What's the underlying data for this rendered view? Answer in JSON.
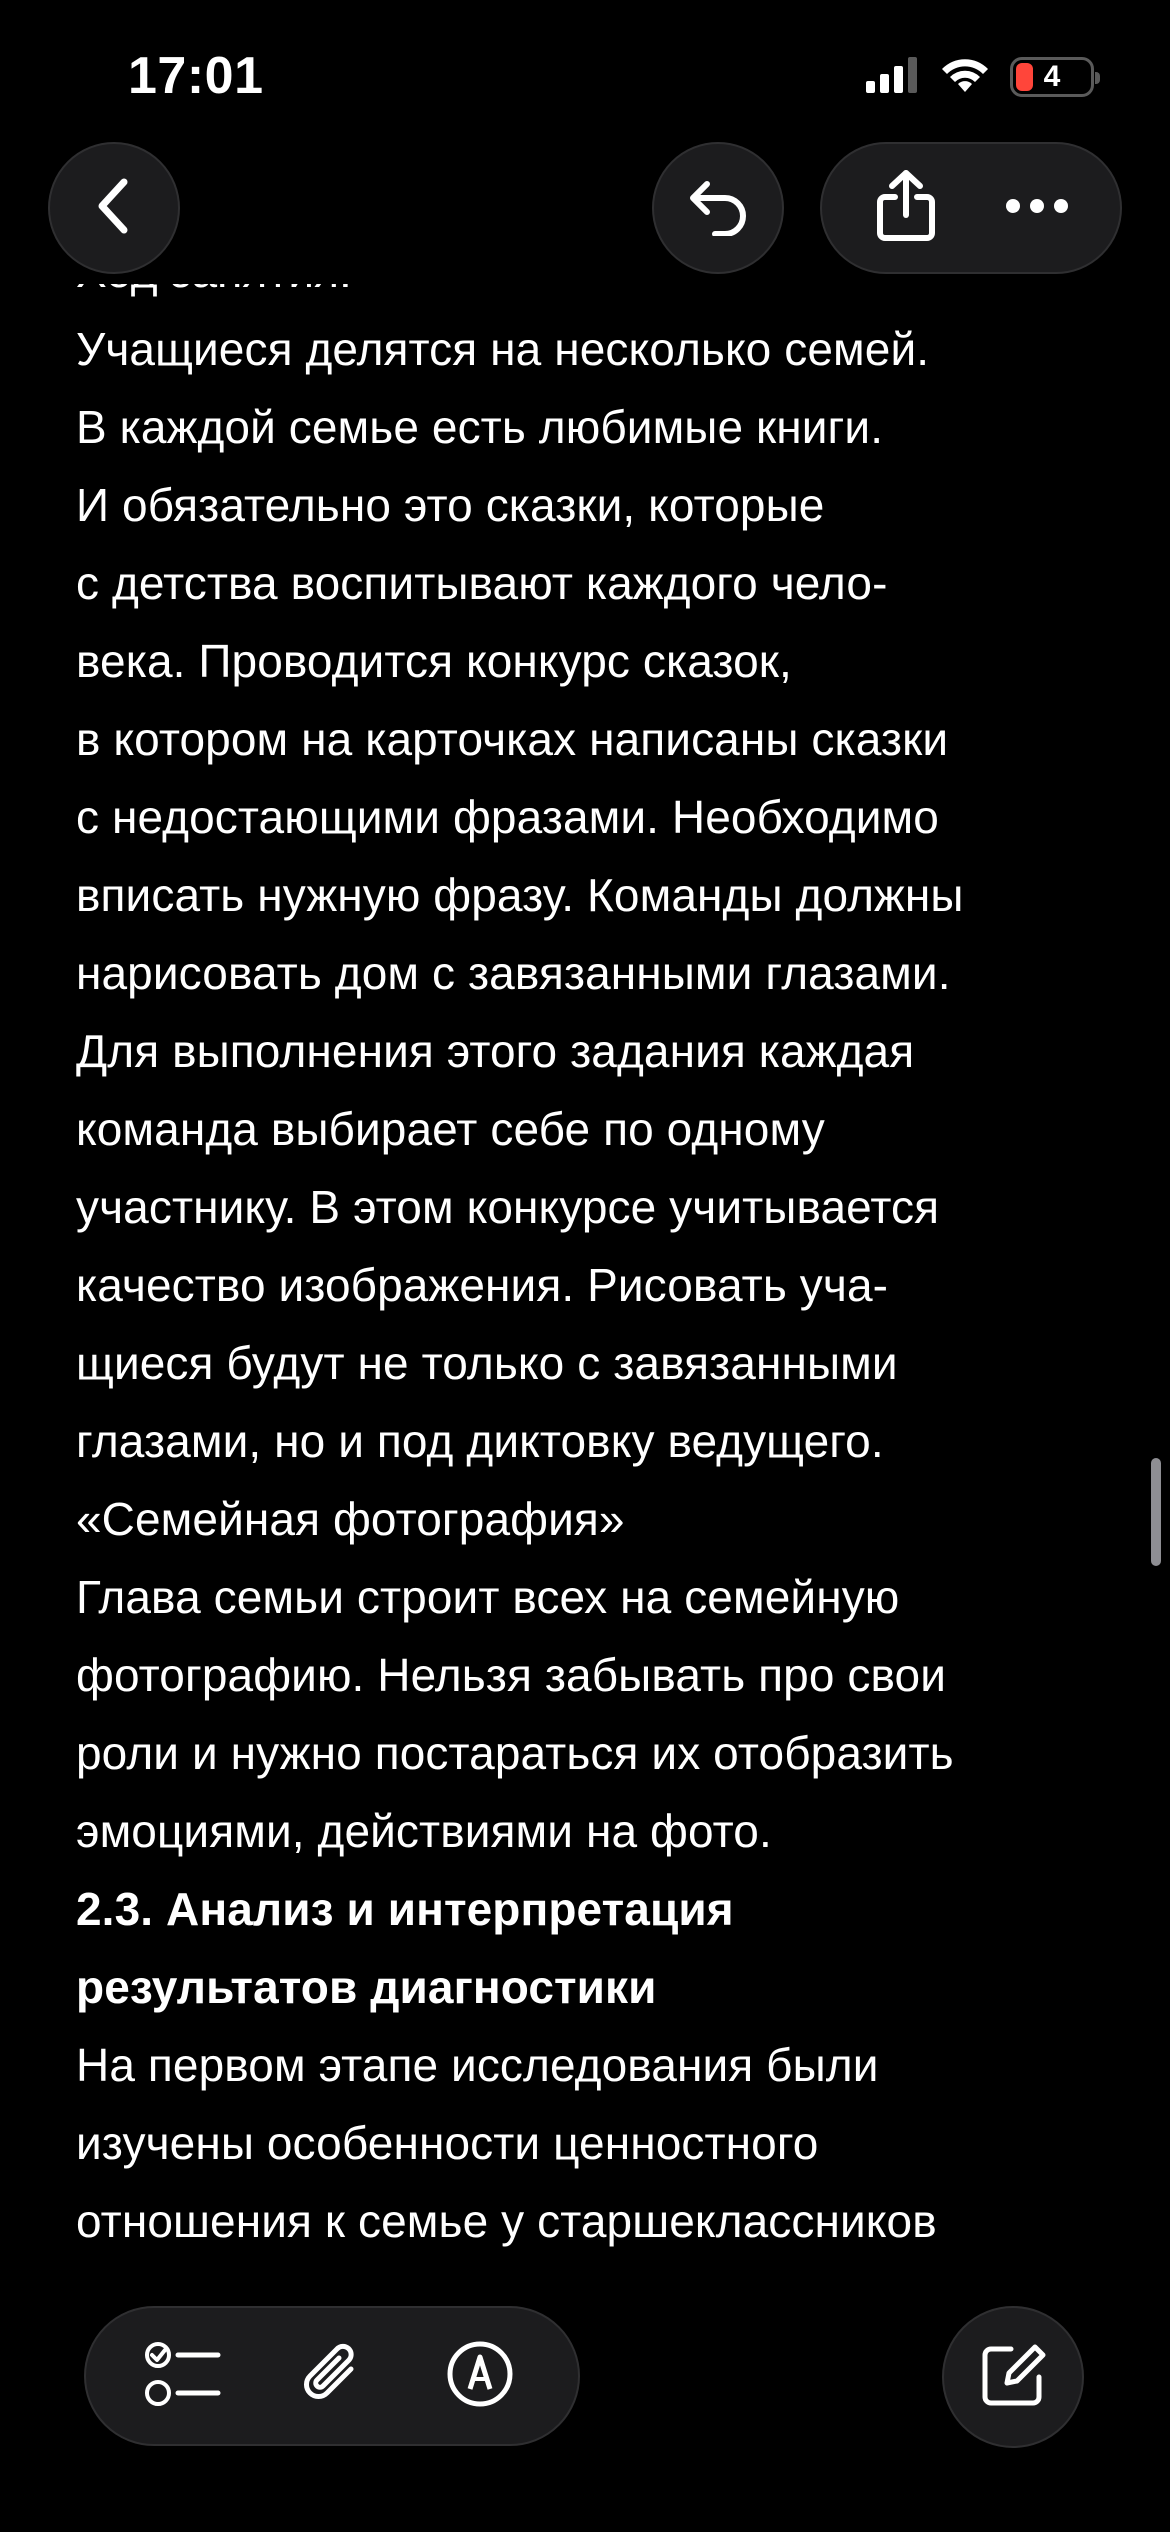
{
  "status_bar": {
    "time": "17:01",
    "battery_level": "4",
    "icons": [
      "cellular-signal-icon",
      "wifi-icon",
      "battery-icon"
    ]
  },
  "top_bar": {
    "buttons": [
      "back-icon",
      "undo-icon",
      "share-icon",
      "more-icon"
    ]
  },
  "note": {
    "cutoff_heading": "Ход занятия:",
    "lines": [
      {
        "text": "Учащиеся делятся на несколько семей.",
        "bold": false
      },
      {
        "text": "В каждой семье есть любимые книги.",
        "bold": false
      },
      {
        "text": "И обязательно это сказки, которые",
        "bold": false
      },
      {
        "text": "с детства воспитывают каждого чело-",
        "bold": false
      },
      {
        "text": "века. Проводится конкурс сказок,",
        "bold": false
      },
      {
        "text": "в котором на карточках написаны сказки",
        "bold": false
      },
      {
        "text": "с недостающими фразами. Необходимо",
        "bold": false
      },
      {
        "text": "вписать нужную фразу. Команды должны",
        "bold": false
      },
      {
        "text": "нарисовать дом с завязанными глазами.",
        "bold": false
      },
      {
        "text": "Для выполнения этого задания каждая",
        "bold": false
      },
      {
        "text": "команда выбирает себе по одному",
        "bold": false
      },
      {
        "text": "участнику. В этом конкурсе учитывается",
        "bold": false
      },
      {
        "text": "качество изображения. Рисовать уча-",
        "bold": false
      },
      {
        "text": "щиеся будут не только с завязанными",
        "bold": false
      },
      {
        "text": "глазами, но и под диктовку ведущего.",
        "bold": false
      },
      {
        "text": "«Семейная фотография»",
        "bold": false
      },
      {
        "text": "Глава семьи строит всех на семейную",
        "bold": false
      },
      {
        "text": "фотографию. Нельзя забывать про свои",
        "bold": false
      },
      {
        "text": "роли и нужно постараться их отобразить",
        "bold": false
      },
      {
        "text": "эмоциями, действиями на фото.",
        "bold": false
      },
      {
        "text": "2.3. Анализ и интерпретация",
        "bold": true
      },
      {
        "text": "результатов диагностики",
        "bold": true
      },
      {
        "text": "На первом этапе исследования были",
        "bold": false
      },
      {
        "text": "изучены особенности ценностного",
        "bold": false
      },
      {
        "text": "отношения к семье у старшеклассников",
        "bold": false
      }
    ]
  },
  "bottom_toolbar": {
    "buttons": [
      "checklist-icon",
      "attachment-icon",
      "markup-icon",
      "compose-icon"
    ]
  },
  "colors": {
    "background": "#000000",
    "text": "#ffffff",
    "button_fill": "#1c1c1e",
    "battery_low": "#ff453a"
  }
}
